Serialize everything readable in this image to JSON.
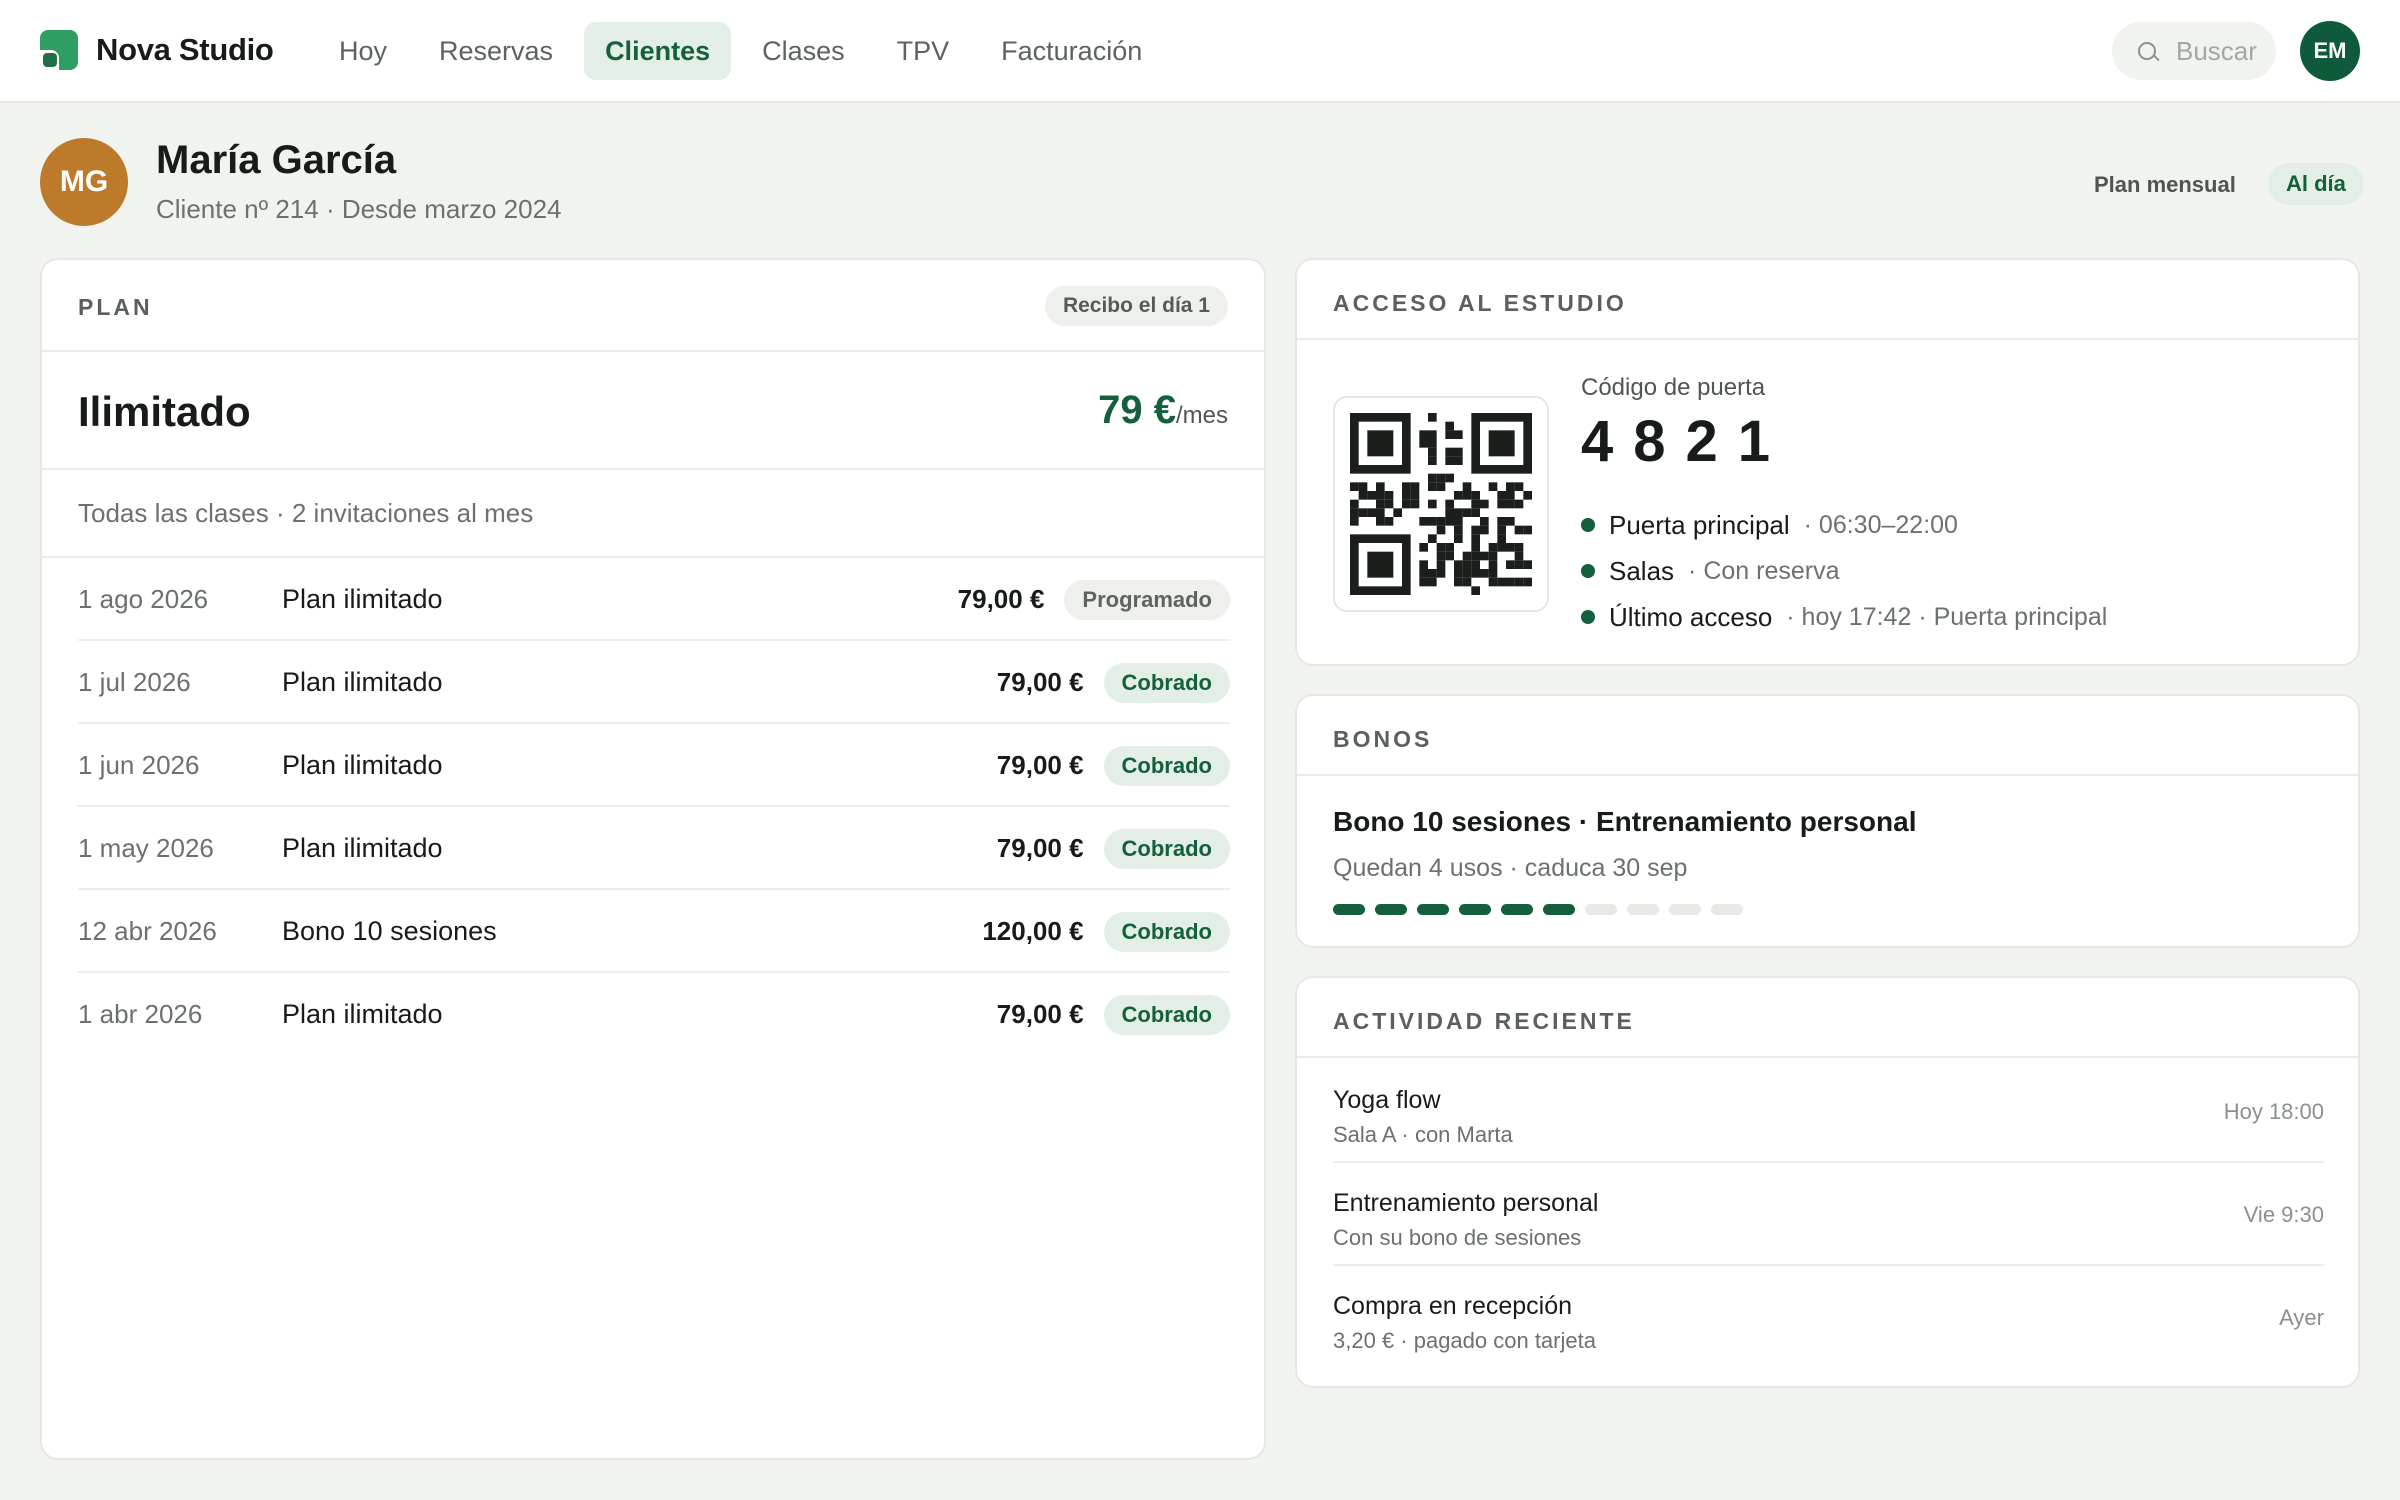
{
  "app": {
    "name": "Nova Studio",
    "nav": [
      {
        "label": "Hoy",
        "active": false
      },
      {
        "label": "Reservas",
        "active": false
      },
      {
        "label": "Clientes",
        "active": true
      },
      {
        "label": "Clases",
        "active": false
      },
      {
        "label": "TPV",
        "active": false
      },
      {
        "label": "Facturación",
        "active": false
      }
    ],
    "search_placeholder": "Buscar",
    "user_initials": "EM"
  },
  "client": {
    "initials": "MG",
    "name": "María García",
    "subtitle": "Cliente nº 214 · Desde marzo 2024",
    "plan_label": "Plan mensual",
    "status_badge": "Al día"
  },
  "plan": {
    "title": "Plan",
    "billing_day": "Recibo el día 1",
    "name": "Ilimitado",
    "price": "79 €",
    "price_period": "/mes",
    "description": "Todas las clases · 2 invitaciones al mes",
    "invoices": [
      {
        "date": "1 ago 2026",
        "concept": "Plan ilimitado",
        "amount": "79,00 €",
        "status": "Programado",
        "paid": false
      },
      {
        "date": "1 jul 2026",
        "concept": "Plan ilimitado",
        "amount": "79,00 €",
        "status": "Cobrado",
        "paid": true
      },
      {
        "date": "1 jun 2026",
        "concept": "Plan ilimitado",
        "amount": "79,00 €",
        "status": "Cobrado",
        "paid": true
      },
      {
        "date": "1 may 2026",
        "concept": "Plan ilimitado",
        "amount": "79,00 €",
        "status": "Cobrado",
        "paid": true
      },
      {
        "date": "12 abr 2026",
        "concept": "Bono 10 sesiones",
        "amount": "120,00 €",
        "status": "Cobrado",
        "paid": true
      },
      {
        "date": "1 abr 2026",
        "concept": "Plan ilimitado",
        "amount": "79,00 €",
        "status": "Cobrado",
        "paid": true
      }
    ]
  },
  "access": {
    "title": "Acceso al estudio",
    "door_code_label": "Código de puerta",
    "door_code": "4821",
    "items": [
      {
        "name": "Puerta principal",
        "detail": "· 06:30–22:00"
      },
      {
        "name": "Salas",
        "detail": "· Con reserva"
      },
      {
        "name": "Último acceso",
        "detail": "· hoy 17:42 · Puerta principal"
      }
    ]
  },
  "bonos": {
    "title": "Bonos",
    "name": "Bono 10 sesiones · Entrenamiento personal",
    "subtitle": "Quedan 4 usos · caduca 30 sep",
    "total_sessions": 10,
    "used_sessions": 6
  },
  "activity": {
    "title": "Actividad reciente",
    "items": [
      {
        "title": "Yoga flow",
        "subtitle": "Sala A · con Marta",
        "time": "Hoy 18:00"
      },
      {
        "title": "Entrenamiento personal",
        "subtitle": "Con su bono de sesiones",
        "time": "Vie 9:30"
      },
      {
        "title": "Compra en recepción",
        "subtitle": "3,20 € · pagado con tarjeta",
        "time": "Ayer"
      }
    ]
  },
  "colors": {
    "brand": "#2f9e63",
    "accent": "#15603c",
    "accent_bg": "#e3efe6",
    "client_avatar": "#bd7a2b"
  }
}
